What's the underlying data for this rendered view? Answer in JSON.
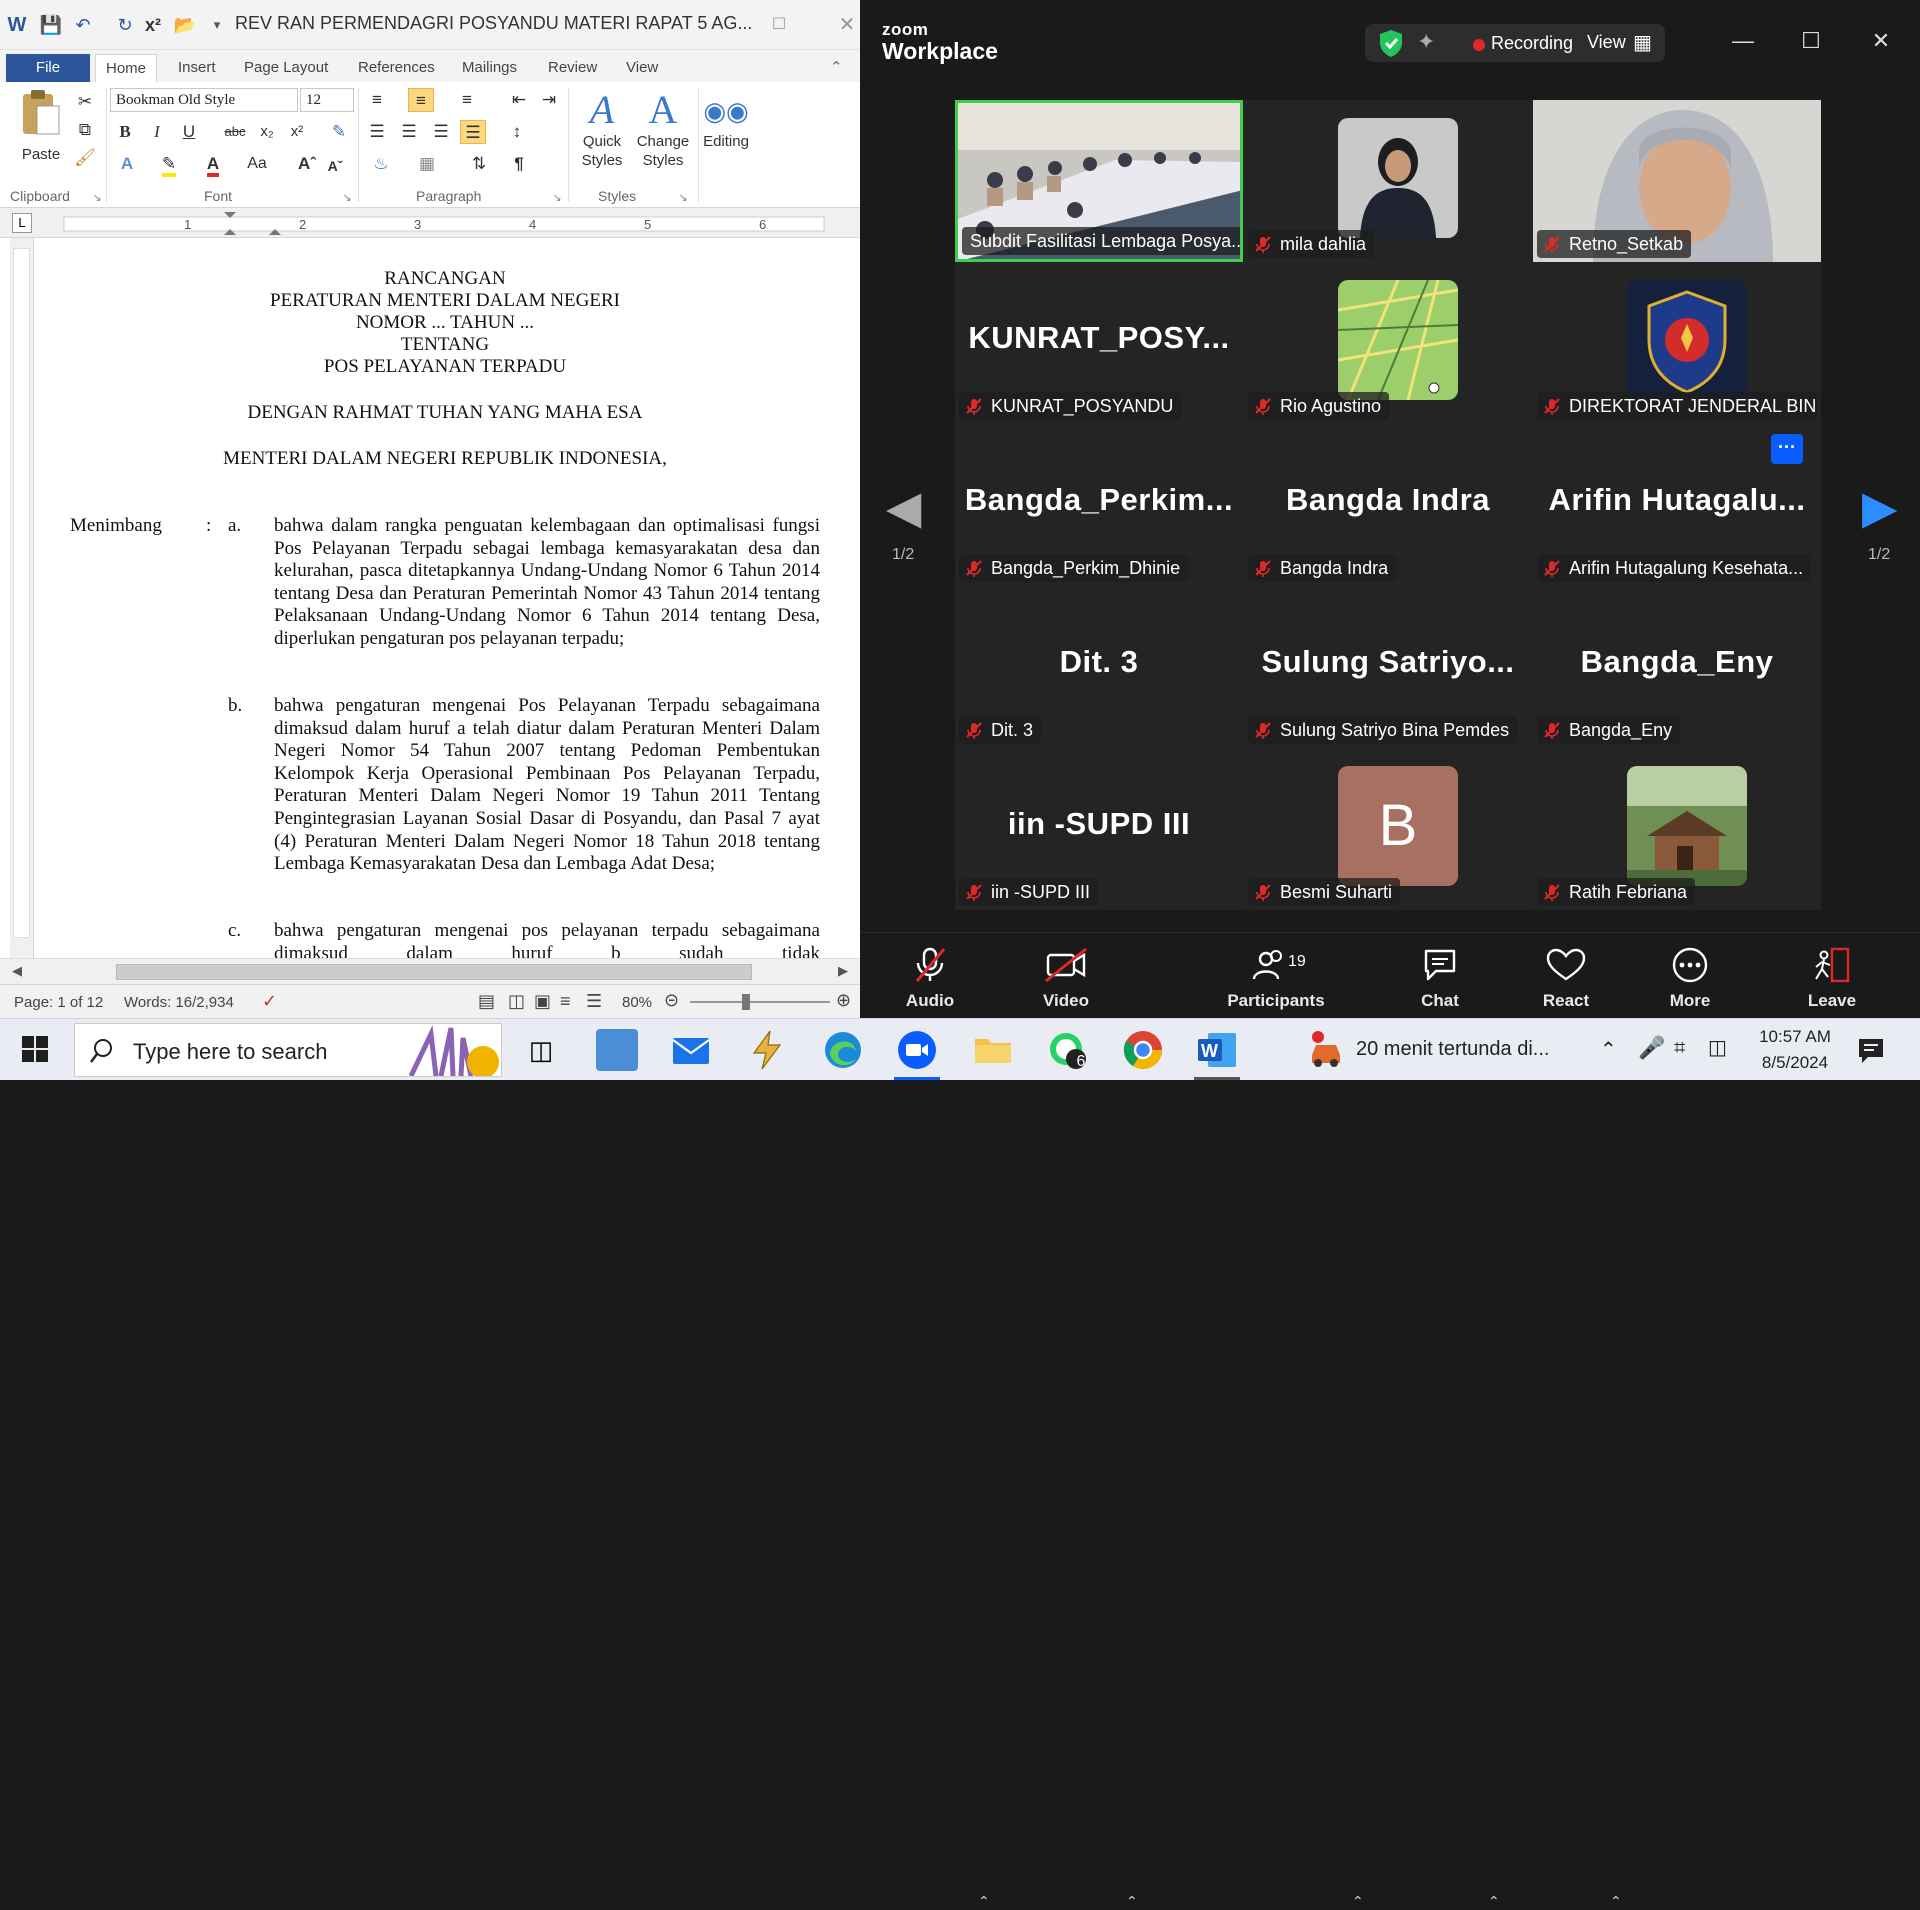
{
  "word": {
    "title": "REV RAN PERMENDAGRI POSYANDU MATERI RAPAT 5 AG...",
    "tabs": [
      "File",
      "Home",
      "Insert",
      "Page Layout",
      "References",
      "Mailings",
      "Review",
      "View"
    ],
    "font_name": "Bookman Old Style",
    "font_size": "12",
    "groups": {
      "clipboard": "Clipboard",
      "font": "Font",
      "paragraph": "Paragraph",
      "styles": "Styles"
    },
    "paste_label": "Paste",
    "quick_styles": "Quick Styles",
    "change_styles": "Change Styles",
    "editing": "Editing",
    "doc": {
      "heading": [
        "RANCANGAN",
        "PERATURAN MENTERI DALAM NEGERI",
        "NOMOR ... TAHUN ...",
        "TENTANG",
        "POS PELAYANAN TERPADU"
      ],
      "blessing": "DENGAN RAHMAT TUHAN YANG MAHA ESA",
      "minister": "MENTERI DALAM NEGERI REPUBLIK INDONESIA,",
      "menimbang": "Menimbang",
      "colon": ":",
      "items": [
        {
          "label": "a.",
          "text": "bahwa dalam rangka penguatan kelembagaan dan optimalisasi fungsi Pos Pelayanan Terpadu sebagai lembaga kemasyarakatan desa dan kelurahan, pasca ditetapkannya Undang-Undang Nomor 6 Tahun 2014 tentang Desa dan Peraturan Pemerintah Nomor 43 Tahun 2014 tentang Pelaksanaan Undang-Undang Nomor 6 Tahun 2014 tentang Desa, diperlukan pengaturan pos pelayanan terpadu;"
        },
        {
          "label": "b.",
          "text": "bahwa pengaturan mengenai Pos Pelayanan Terpadu sebagaimana dimaksud dalam huruf a telah diatur dalam Peraturan Menteri Dalam Negeri Nomor 54 Tahun 2007 tentang Pedoman Pembentukan Kelompok Kerja Operasional Pembinaan Pos Pelayanan Terpadu, Peraturan Menteri Dalam Negeri Nomor 19 Tahun 2011 Tentang Pengintegrasian Layanan Sosial Dasar di Posyandu, dan Pasal 7 ayat (4) Peraturan Menteri Dalam Negeri Nomor 18 Tahun 2018 tentang Lembaga Kemasyarakatan Desa dan Lembaga Adat Desa;"
        },
        {
          "label": "c.",
          "text": "bahwa pengaturan mengenai pos pelayanan terpadu sebagaimana dimaksud dalam huruf b sudah tidak"
        }
      ]
    },
    "status": {
      "page": "Page: 1 of 12",
      "words": "Words: 16/2,934",
      "zoom": "80%"
    }
  },
  "zoom": {
    "brand_top": "zoom",
    "brand_bottom": "Workplace",
    "recording": "Recording",
    "view": "View",
    "page_left": "1/2",
    "page_right": "1/2",
    "tiles": [
      {
        "big": "",
        "name": "Subdit Fasilitasi Lembaga Posya..."
      },
      {
        "big": "",
        "name": "mila dahlia"
      },
      {
        "big": "",
        "name": "Retno_Setkab"
      },
      {
        "big": "KUNRAT_POSY...",
        "name": "KUNRAT_POSYANDU"
      },
      {
        "big": "",
        "name": "Rio Agustino"
      },
      {
        "big": "",
        "name": "DIREKTORAT JENDERAL BIN..."
      },
      {
        "big": "Bangda_Perkim...",
        "name": "Bangda_Perkim_Dhinie"
      },
      {
        "big": "Bangda Indra",
        "name": "Bangda Indra"
      },
      {
        "big": "Arifin  Hutagalu...",
        "name": "Arifin Hutagalung Kesehata..."
      },
      {
        "big": "Dit. 3",
        "name": "Dit. 3"
      },
      {
        "big": "Sulung  Satriyo...",
        "name": "Sulung Satriyo Bina Pemdes"
      },
      {
        "big": "Bangda_Eny",
        "name": "Bangda_Eny"
      },
      {
        "big": "iin -SUPD III",
        "name": "iin -SUPD III"
      },
      {
        "big": "",
        "name": "Besmi Suharti"
      },
      {
        "big": "",
        "name": "Ratih Febriana"
      }
    ],
    "avatar_letter": "B",
    "more_dots": "···",
    "toolbar": {
      "audio": "Audio",
      "video": "Video",
      "participants": "Participants",
      "participants_count": "19",
      "chat": "Chat",
      "react": "React",
      "more": "More",
      "leave": "Leave"
    }
  },
  "taskbar": {
    "search_placeholder": "Type here to search",
    "notification": "20 menit tertunda di...",
    "time": "10:57 AM",
    "date": "8/5/2024",
    "chrome_badge": "6"
  },
  "colors": {
    "word_blue": "#2b579a",
    "zoom_bg": "#1a1a1a",
    "tile_bg": "#242424",
    "active_speaker": "#3ccf4e",
    "recording_red": "#e02828",
    "mic_off_red": "#e02828",
    "zoom_blue": "#0b5cff"
  }
}
